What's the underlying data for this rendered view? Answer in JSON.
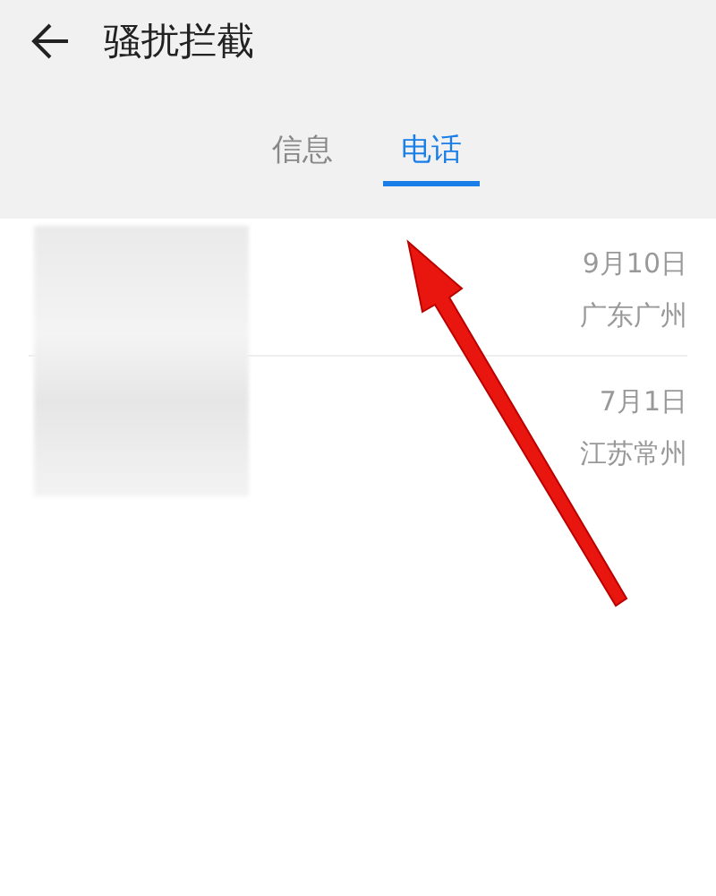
{
  "header": {
    "title": "骚扰拦截"
  },
  "tabs": [
    {
      "label": "信息",
      "selected": false
    },
    {
      "label": "电话",
      "selected": true
    }
  ],
  "calls": [
    {
      "date": "9月10日",
      "location": "广东广州"
    },
    {
      "date": "7月1日",
      "location": "江苏常州"
    }
  ]
}
